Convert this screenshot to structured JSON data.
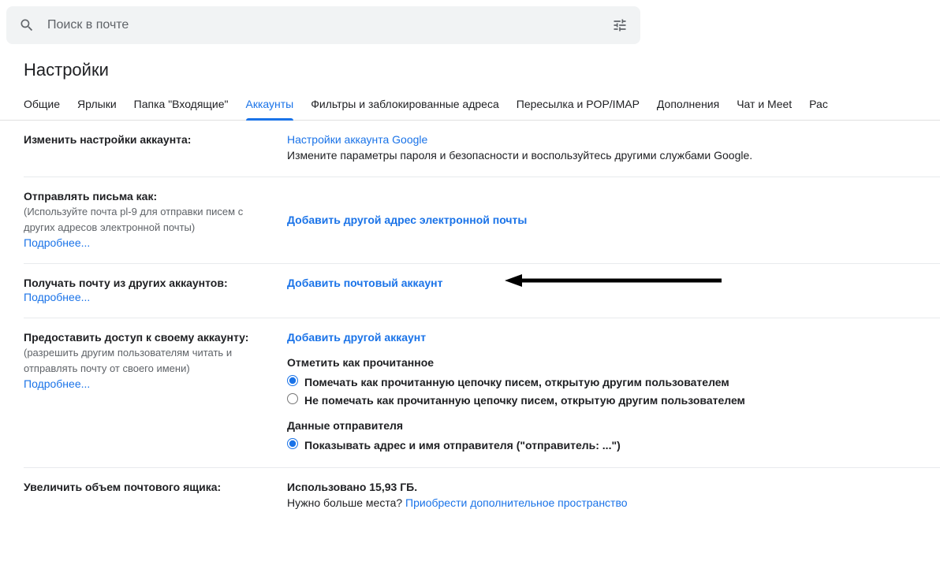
{
  "search": {
    "placeholder": "Поиск в почте"
  },
  "page_title": "Настройки",
  "tabs": [
    {
      "label": "Общие",
      "active": false
    },
    {
      "label": "Ярлыки",
      "active": false
    },
    {
      "label": "Папка \"Входящие\"",
      "active": false
    },
    {
      "label": "Аккаунты",
      "active": true
    },
    {
      "label": "Фильтры и заблокированные адреса",
      "active": false
    },
    {
      "label": "Пересылка и POP/IMAP",
      "active": false
    },
    {
      "label": "Дополнения",
      "active": false
    },
    {
      "label": "Чат и Meet",
      "active": false
    },
    {
      "label": "Рас",
      "active": false
    }
  ],
  "sections": {
    "account_settings": {
      "title": "Изменить настройки аккаунта:",
      "link": "Настройки аккаунта Google",
      "desc": "Измените параметры пароля и безопасности и воспользуйтесь другими службами Google."
    },
    "send_as": {
      "title": "Отправлять письма как:",
      "subtitle": "(Используйте почта pl-9 для отправки писем с других адресов электронной почты)",
      "more": "Подробнее...",
      "link": "Добавить другой адрес электронной почты"
    },
    "check_mail": {
      "title": "Получать почту из других аккаунтов:",
      "more": "Подробнее...",
      "link": "Добавить почтовый аккаунт"
    },
    "grant_access": {
      "title": "Предоставить доступ к своему аккаунту:",
      "subtitle": "(разрешить другим пользователям читать и отправлять почту от своего имени)",
      "more": "Подробнее...",
      "link": "Добавить другой аккаунт",
      "mark_heading": "Отметить как прочитанное",
      "radio_mark_read": "Помечать как прочитанную цепочку писем, открытую другим пользователем",
      "radio_dont_mark": "Не помечать как прочитанную цепочку писем, открытую другим пользователем",
      "sender_heading": "Данные отправителя",
      "radio_show_sender": "Показывать адрес и имя отправителя (\"отправитель: ...\")"
    },
    "storage": {
      "title": "Увеличить объем почтового ящика:",
      "used": "Использовано 15,93 ГБ.",
      "need_more": "Нужно больше места? ",
      "buy_link": "Приобрести дополнительное пространство"
    }
  }
}
